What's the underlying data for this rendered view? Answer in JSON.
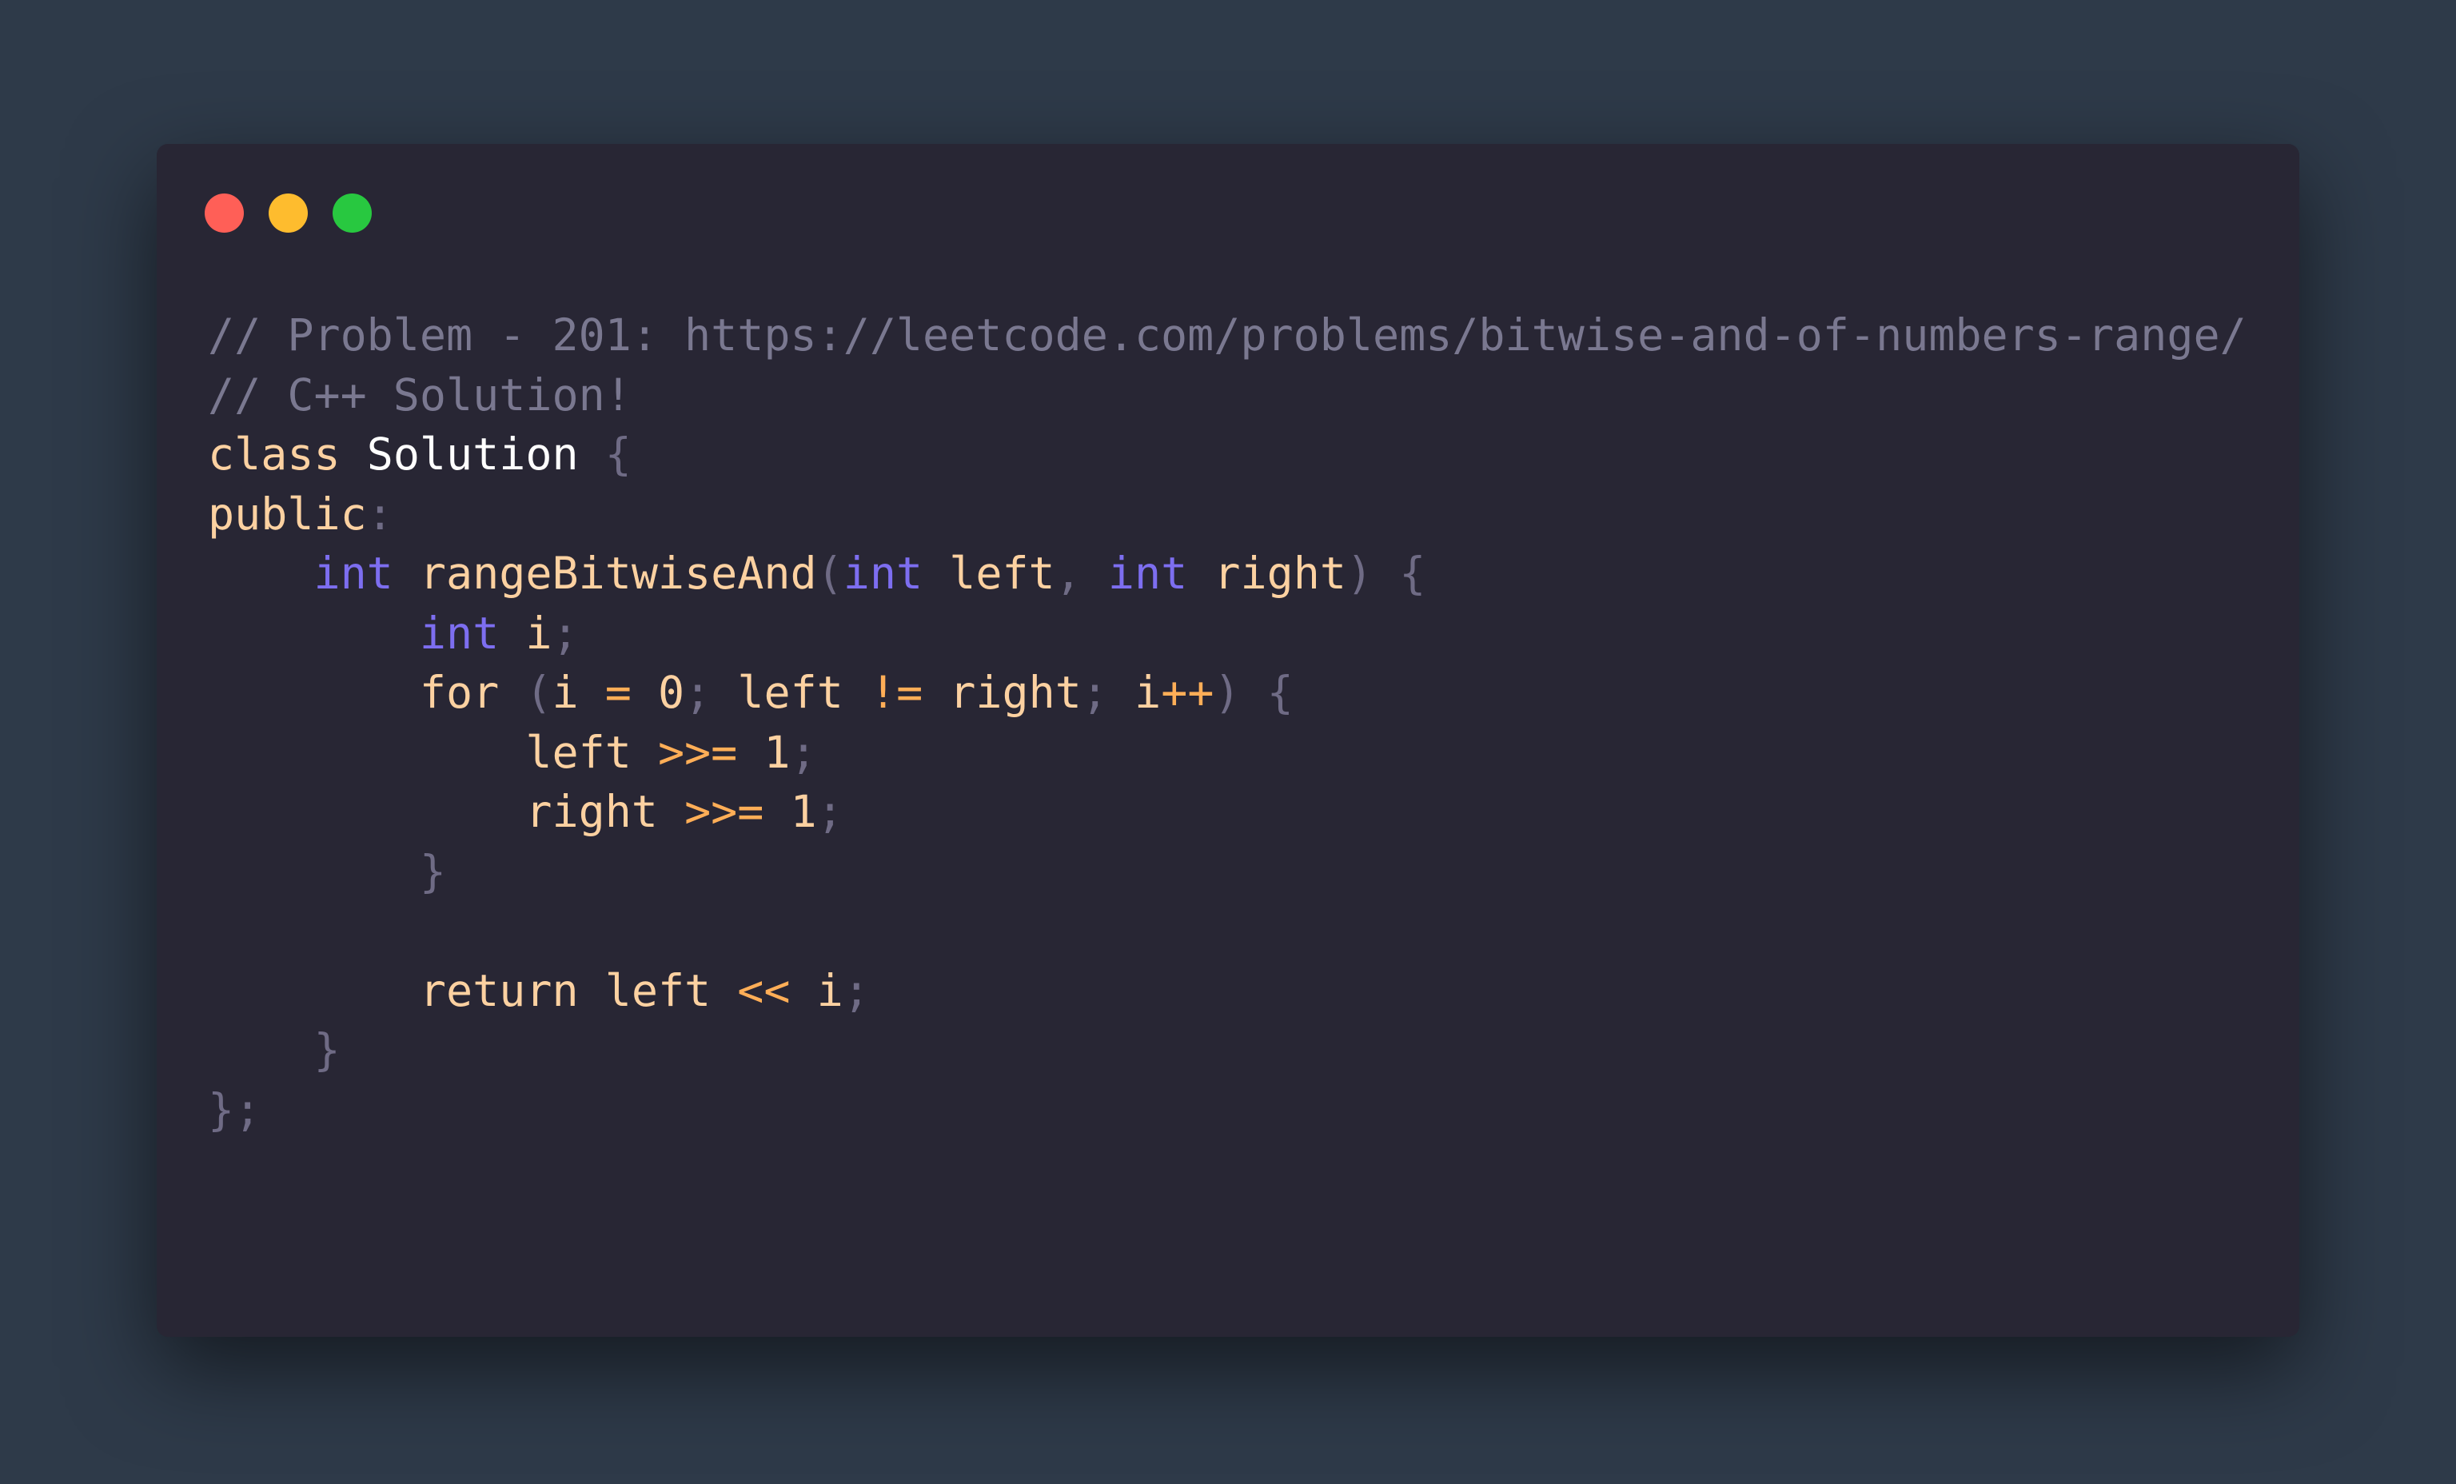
{
  "window": {
    "controls": [
      {
        "name": "close",
        "color": "#ff5f57"
      },
      {
        "name": "minimize",
        "color": "#febc2e"
      },
      {
        "name": "maximize",
        "color": "#28c840"
      }
    ]
  },
  "colors": {
    "background": "#2e3a49",
    "editor": "#282634",
    "comment": "#7a7890",
    "keyword": "#fcd1a1",
    "type": "#7d6ef0",
    "operator": "#ffae57",
    "punctuation": "#6f6b85"
  },
  "code": {
    "language": "C++",
    "lines": [
      [
        {
          "t": "// Problem - 201: https://leetcode.com/problems/bitwise-and-of-numbers-range/",
          "k": "comment"
        }
      ],
      [
        {
          "t": "// C++ Solution!",
          "k": "comment"
        }
      ],
      [
        {
          "t": "class",
          "k": "keyword"
        },
        {
          "t": " ",
          "k": "ws"
        },
        {
          "t": "Solution",
          "k": "name"
        },
        {
          "t": " ",
          "k": "ws"
        },
        {
          "t": "{",
          "k": "punct"
        }
      ],
      [
        {
          "t": "public",
          "k": "keyword"
        },
        {
          "t": ":",
          "k": "punct"
        }
      ],
      [
        {
          "t": "    ",
          "k": "ws"
        },
        {
          "t": "int",
          "k": "type"
        },
        {
          "t": " ",
          "k": "ws"
        },
        {
          "t": "rangeBitwiseAnd",
          "k": "func"
        },
        {
          "t": "(",
          "k": "punct"
        },
        {
          "t": "int",
          "k": "type"
        },
        {
          "t": " ",
          "k": "ws"
        },
        {
          "t": "left",
          "k": "ident"
        },
        {
          "t": ",",
          "k": "punct"
        },
        {
          "t": " ",
          "k": "ws"
        },
        {
          "t": "int",
          "k": "type"
        },
        {
          "t": " ",
          "k": "ws"
        },
        {
          "t": "right",
          "k": "ident"
        },
        {
          "t": ")",
          "k": "punct"
        },
        {
          "t": " ",
          "k": "ws"
        },
        {
          "t": "{",
          "k": "punct"
        }
      ],
      [
        {
          "t": "        ",
          "k": "ws"
        },
        {
          "t": "int",
          "k": "type"
        },
        {
          "t": " ",
          "k": "ws"
        },
        {
          "t": "i",
          "k": "ident"
        },
        {
          "t": ";",
          "k": "punct"
        }
      ],
      [
        {
          "t": "        ",
          "k": "ws"
        },
        {
          "t": "for",
          "k": "keyword"
        },
        {
          "t": " ",
          "k": "ws"
        },
        {
          "t": "(",
          "k": "punct"
        },
        {
          "t": "i",
          "k": "ident"
        },
        {
          "t": " ",
          "k": "ws"
        },
        {
          "t": "=",
          "k": "op"
        },
        {
          "t": " ",
          "k": "ws"
        },
        {
          "t": "0",
          "k": "num"
        },
        {
          "t": ";",
          "k": "punct"
        },
        {
          "t": " ",
          "k": "ws"
        },
        {
          "t": "left",
          "k": "ident"
        },
        {
          "t": " ",
          "k": "ws"
        },
        {
          "t": "!=",
          "k": "op"
        },
        {
          "t": " ",
          "k": "ws"
        },
        {
          "t": "right",
          "k": "ident"
        },
        {
          "t": ";",
          "k": "punct"
        },
        {
          "t": " ",
          "k": "ws"
        },
        {
          "t": "i",
          "k": "ident"
        },
        {
          "t": "++",
          "k": "op"
        },
        {
          "t": ")",
          "k": "punct"
        },
        {
          "t": " ",
          "k": "ws"
        },
        {
          "t": "{",
          "k": "punct"
        }
      ],
      [
        {
          "t": "            ",
          "k": "ws"
        },
        {
          "t": "left",
          "k": "ident"
        },
        {
          "t": " ",
          "k": "ws"
        },
        {
          "t": ">>=",
          "k": "op"
        },
        {
          "t": " ",
          "k": "ws"
        },
        {
          "t": "1",
          "k": "num"
        },
        {
          "t": ";",
          "k": "punct"
        }
      ],
      [
        {
          "t": "            ",
          "k": "ws"
        },
        {
          "t": "right",
          "k": "ident"
        },
        {
          "t": " ",
          "k": "ws"
        },
        {
          "t": ">>=",
          "k": "op"
        },
        {
          "t": " ",
          "k": "ws"
        },
        {
          "t": "1",
          "k": "num"
        },
        {
          "t": ";",
          "k": "punct"
        }
      ],
      [
        {
          "t": "        ",
          "k": "ws"
        },
        {
          "t": "}",
          "k": "punct"
        }
      ],
      [],
      [
        {
          "t": "        ",
          "k": "ws"
        },
        {
          "t": "return",
          "k": "keyword"
        },
        {
          "t": " ",
          "k": "ws"
        },
        {
          "t": "left",
          "k": "ident"
        },
        {
          "t": " ",
          "k": "ws"
        },
        {
          "t": "<<",
          "k": "op"
        },
        {
          "t": " ",
          "k": "ws"
        },
        {
          "t": "i",
          "k": "ident"
        },
        {
          "t": ";",
          "k": "punct"
        }
      ],
      [
        {
          "t": "    ",
          "k": "ws"
        },
        {
          "t": "}",
          "k": "punct"
        }
      ],
      [
        {
          "t": "};",
          "k": "punct"
        }
      ]
    ]
  }
}
